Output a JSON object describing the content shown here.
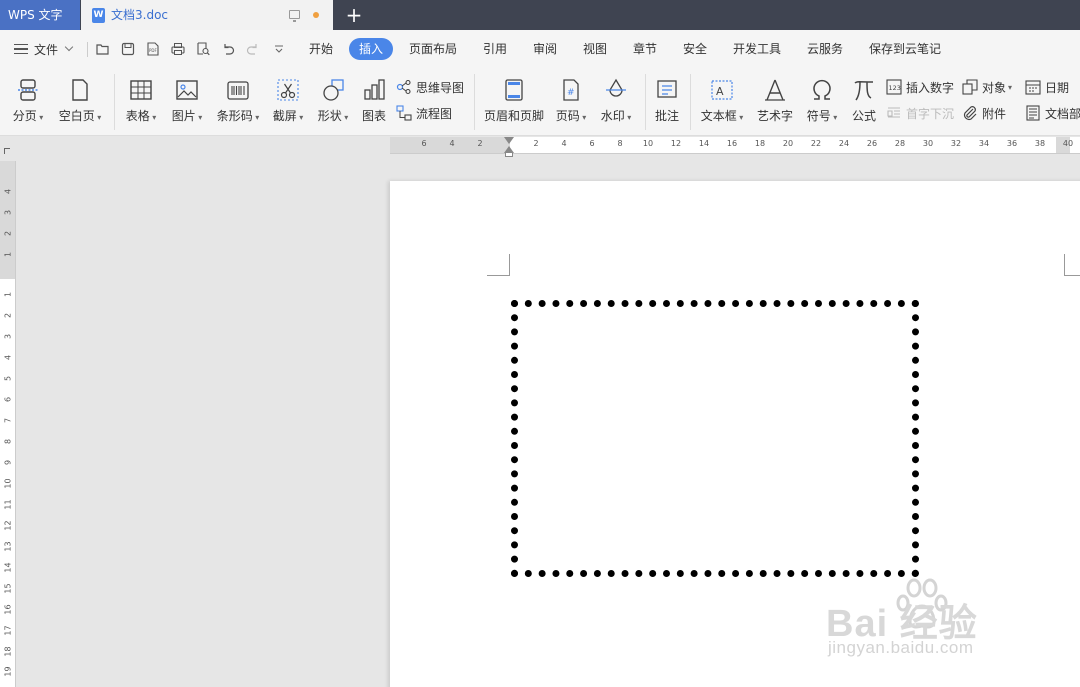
{
  "titlebar": {
    "app_name": "WPS 文字",
    "doc_tab": "文档3.doc",
    "doc_icon_letter": "W",
    "new_tab": "+"
  },
  "menubar": {
    "file_label": "文件",
    "items": [
      "开始",
      "插入",
      "页面布局",
      "引用",
      "审阅",
      "视图",
      "章节",
      "安全",
      "开发工具",
      "云服务",
      "保存到云笔记"
    ],
    "active_item": "插入"
  },
  "ribbon": {
    "fenye": "分页",
    "kongbaiye": "空白页",
    "biaoge": "表格",
    "tupian": "图片",
    "tiaoxingma": "条形码",
    "jieping": "截屏",
    "xingzhuang": "形状",
    "tubiao": "图表",
    "siwei": "思维导图",
    "liucheng": "流程图",
    "yemei": "页眉和页脚",
    "yema": "页码",
    "shuiyin": "水印",
    "pizhu": "批注",
    "wenbenkuang": "文本框",
    "yishuzi": "艺术字",
    "fuhao": "符号",
    "gongshi": "公式",
    "charu_shuzi": "插入数字",
    "shouzi_xiachen": "首字下沉",
    "duixiang": "对象",
    "fujian": "附件",
    "riqi": "日期",
    "wendangbu": "文档部"
  },
  "hruler": {
    "ticks": [
      "6",
      "4",
      "2",
      "2",
      "4",
      "6",
      "8",
      "10",
      "12",
      "14",
      "16",
      "18",
      "20",
      "22",
      "24",
      "26",
      "28",
      "30",
      "32",
      "34",
      "36",
      "38",
      "40"
    ]
  },
  "vruler": {
    "ticks_top": [
      "4",
      "3",
      "2",
      "1"
    ],
    "ticks_body": [
      "1",
      "2",
      "3",
      "4",
      "5",
      "6",
      "7",
      "8",
      "9",
      "10",
      "11",
      "12",
      "13",
      "14",
      "15",
      "16",
      "17",
      "18",
      "19"
    ]
  },
  "watermark": {
    "logo": "Bai  经验",
    "url": "jingyan.baidu.com"
  },
  "colors": {
    "titlebar_bg": "#3f4451",
    "app_tab_bg": "#4a71c4",
    "accent": "#4a86e8",
    "unsaved_dot": "#f0a040"
  }
}
